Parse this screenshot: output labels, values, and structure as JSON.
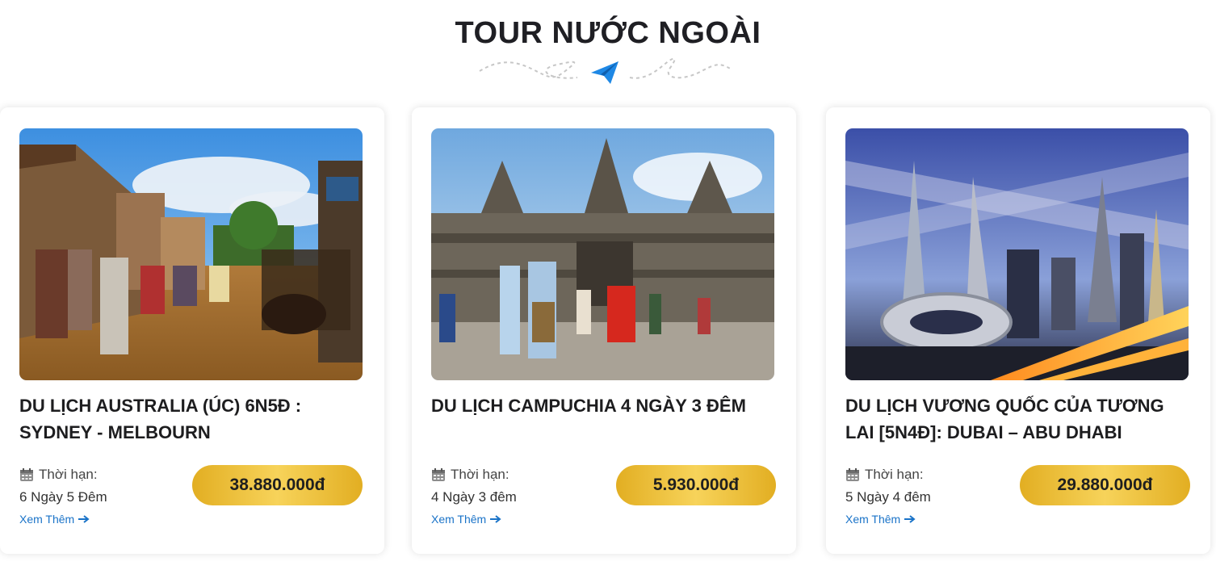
{
  "section": {
    "title": "TOUR NƯỚC NGOÀI"
  },
  "tours": [
    {
      "title": "DU LỊCH AUSTRALIA (ÚC) 6N5Đ : SYDNEY - MELBOURN",
      "duration_label": "Thời hạn:",
      "duration_value": "6 Ngày 5 Đêm",
      "more_label": "Xem Thêm",
      "price": "38.880.000đ",
      "image_icon": "old-town-street-photo"
    },
    {
      "title": "DU LỊCH CAMPUCHIA 4 NGÀY 3 ĐÊM",
      "duration_label": "Thời hạn:",
      "duration_value": "4 Ngày 3 đêm",
      "more_label": "Xem Thêm",
      "price": "5.930.000đ",
      "image_icon": "angkor-temple-photo"
    },
    {
      "title": "DU LỊCH VƯƠNG QUỐC CỦA TƯƠNG LAI [5N4Đ]: DUBAI – ABU DHABI",
      "duration_label": "Thời hạn:",
      "duration_value": "5 Ngày 4 đêm",
      "more_label": "Xem Thêm",
      "price": "29.880.000đ",
      "image_icon": "dubai-skyline-photo"
    }
  ],
  "colors": {
    "accent_link": "#1a73c8",
    "price_gold": "#e9bb2c",
    "plane_blue": "#1e88e5"
  }
}
